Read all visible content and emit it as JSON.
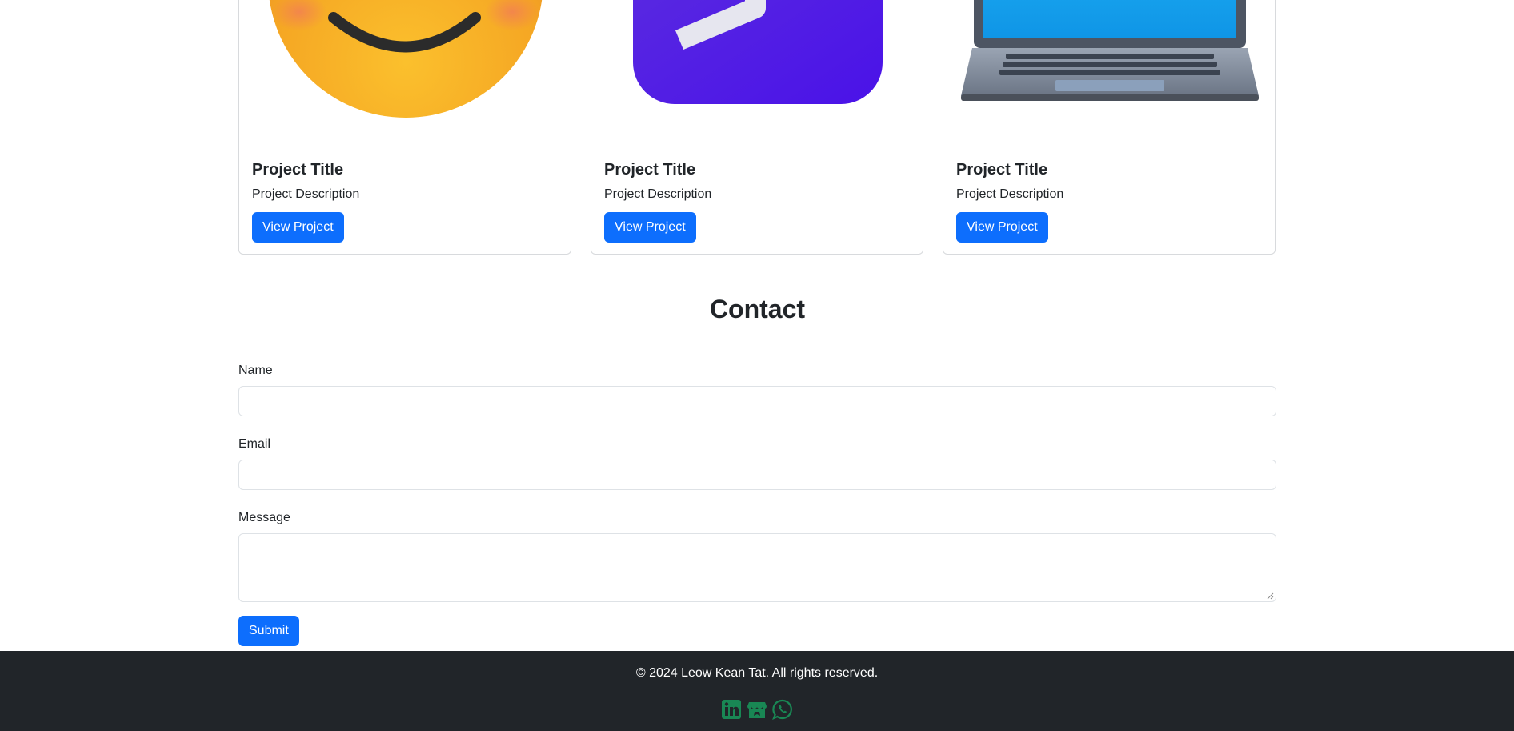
{
  "projects": [
    {
      "title": "Project Title",
      "description": "Project Description",
      "button": "View Project",
      "image_icon": "smiling-face-icon"
    },
    {
      "title": "Project Title",
      "description": "Project Description",
      "button": "View Project",
      "image_icon": "terminal-app-icon"
    },
    {
      "title": "Project Title",
      "description": "Project Description",
      "button": "View Project",
      "image_icon": "laptop-icon"
    }
  ],
  "contact": {
    "title": "Contact",
    "name_label": "Name",
    "name_value": "",
    "email_label": "Email",
    "email_value": "",
    "message_label": "Message",
    "message_value": "",
    "submit_label": "Submit"
  },
  "footer": {
    "copyright": "© 2024 Leow Kean Tat. All rights reserved.",
    "socials": [
      "linkedin-icon",
      "itch-io-icon",
      "whatsapp-icon"
    ],
    "social_color": "#198754"
  },
  "colors": {
    "primary": "#0d6efd",
    "footer_bg": "#212529",
    "text": "#212529"
  }
}
